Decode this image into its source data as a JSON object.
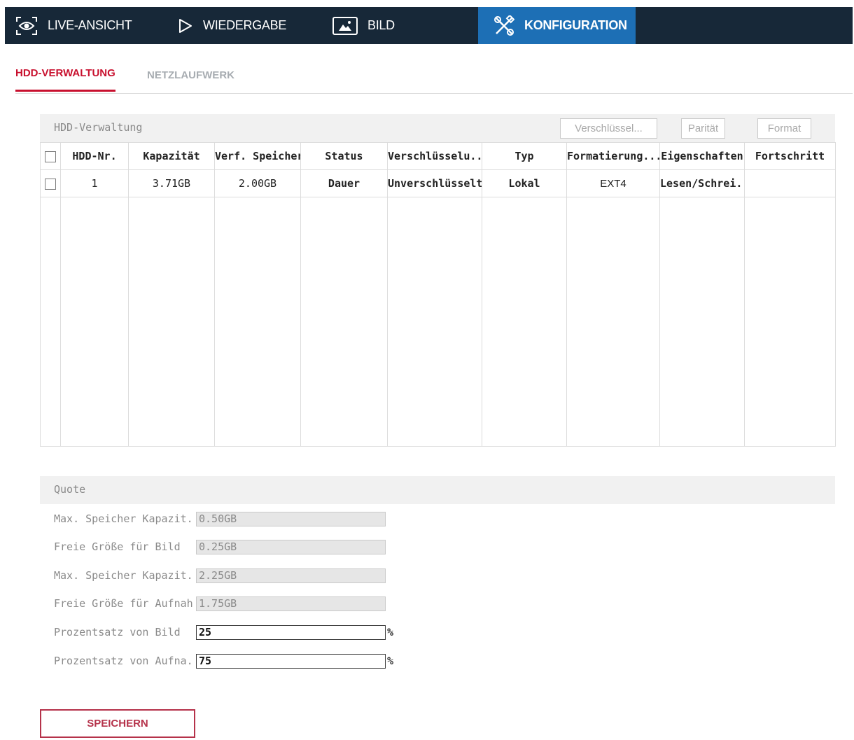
{
  "nav": {
    "items": [
      {
        "label": "LIVE-ANSICHT",
        "icon": "eye-icon"
      },
      {
        "label": "WIEDERGABE",
        "icon": "play-icon"
      },
      {
        "label": "BILD",
        "icon": "image-icon"
      },
      {
        "label": "KONFIGURATION",
        "icon": "tools-icon"
      }
    ],
    "active_index": 3
  },
  "subtabs": {
    "items": [
      {
        "label": "HDD-VERWALTUNG"
      },
      {
        "label": "NETZLAUFWERK"
      }
    ],
    "active_index": 0
  },
  "hdd": {
    "title": "HDD-Verwaltung",
    "buttons": {
      "encrypt": "Verschlüssel...",
      "parity": "Parität",
      "format": "Format"
    },
    "columns": [
      "HDD-Nr.",
      "Kapazität",
      "Verf. Speicher",
      "Status",
      "Verschlüsselu...",
      "Typ",
      "Formatierung...",
      "Eigenschaften",
      "Fortschritt"
    ],
    "rows": [
      {
        "cells": [
          "1",
          "3.71GB",
          "2.00GB",
          "Dauer",
          "Unverschlüsselt",
          "Lokal",
          "EXT4",
          "Lesen/Schrei...",
          ""
        ]
      }
    ]
  },
  "quote": {
    "title": "Quote",
    "fields": [
      {
        "label": "Max. Speicher Kapazit...",
        "value": "0.50GB"
      },
      {
        "label": "Freie Größe für Bild",
        "value": "0.25GB"
      },
      {
        "label": "Max. Speicher Kapazit...",
        "value": "2.25GB"
      },
      {
        "label": "Freie Größe für Aufnah...",
        "value": "1.75GB"
      },
      {
        "label": "Prozentsatz von Bild",
        "value": "25",
        "unit": "%"
      },
      {
        "label": "Prozentsatz von Aufna...",
        "value": "75",
        "unit": "%"
      }
    ]
  },
  "save_label": "SPEICHERN",
  "colors": {
    "nav_bg": "#172838",
    "nav_active": "#1d6fb5",
    "accent_red": "#c8102e",
    "save_border": "#b5324a"
  }
}
